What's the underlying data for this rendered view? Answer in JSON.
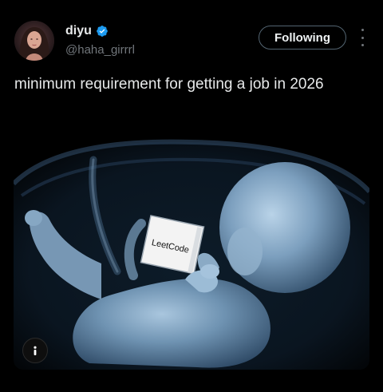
{
  "author": {
    "display_name": "diyu",
    "handle": "@haha_girrrl",
    "verified": true,
    "verified_color": "#1d9bf0"
  },
  "actions": {
    "follow_label": "Following",
    "more_icon": "more-vertical-icon"
  },
  "tweet": {
    "text": "minimum requirement for getting a job in 2026"
  },
  "media": {
    "book_label": "LeetCode",
    "alt_icon": "info-icon"
  }
}
